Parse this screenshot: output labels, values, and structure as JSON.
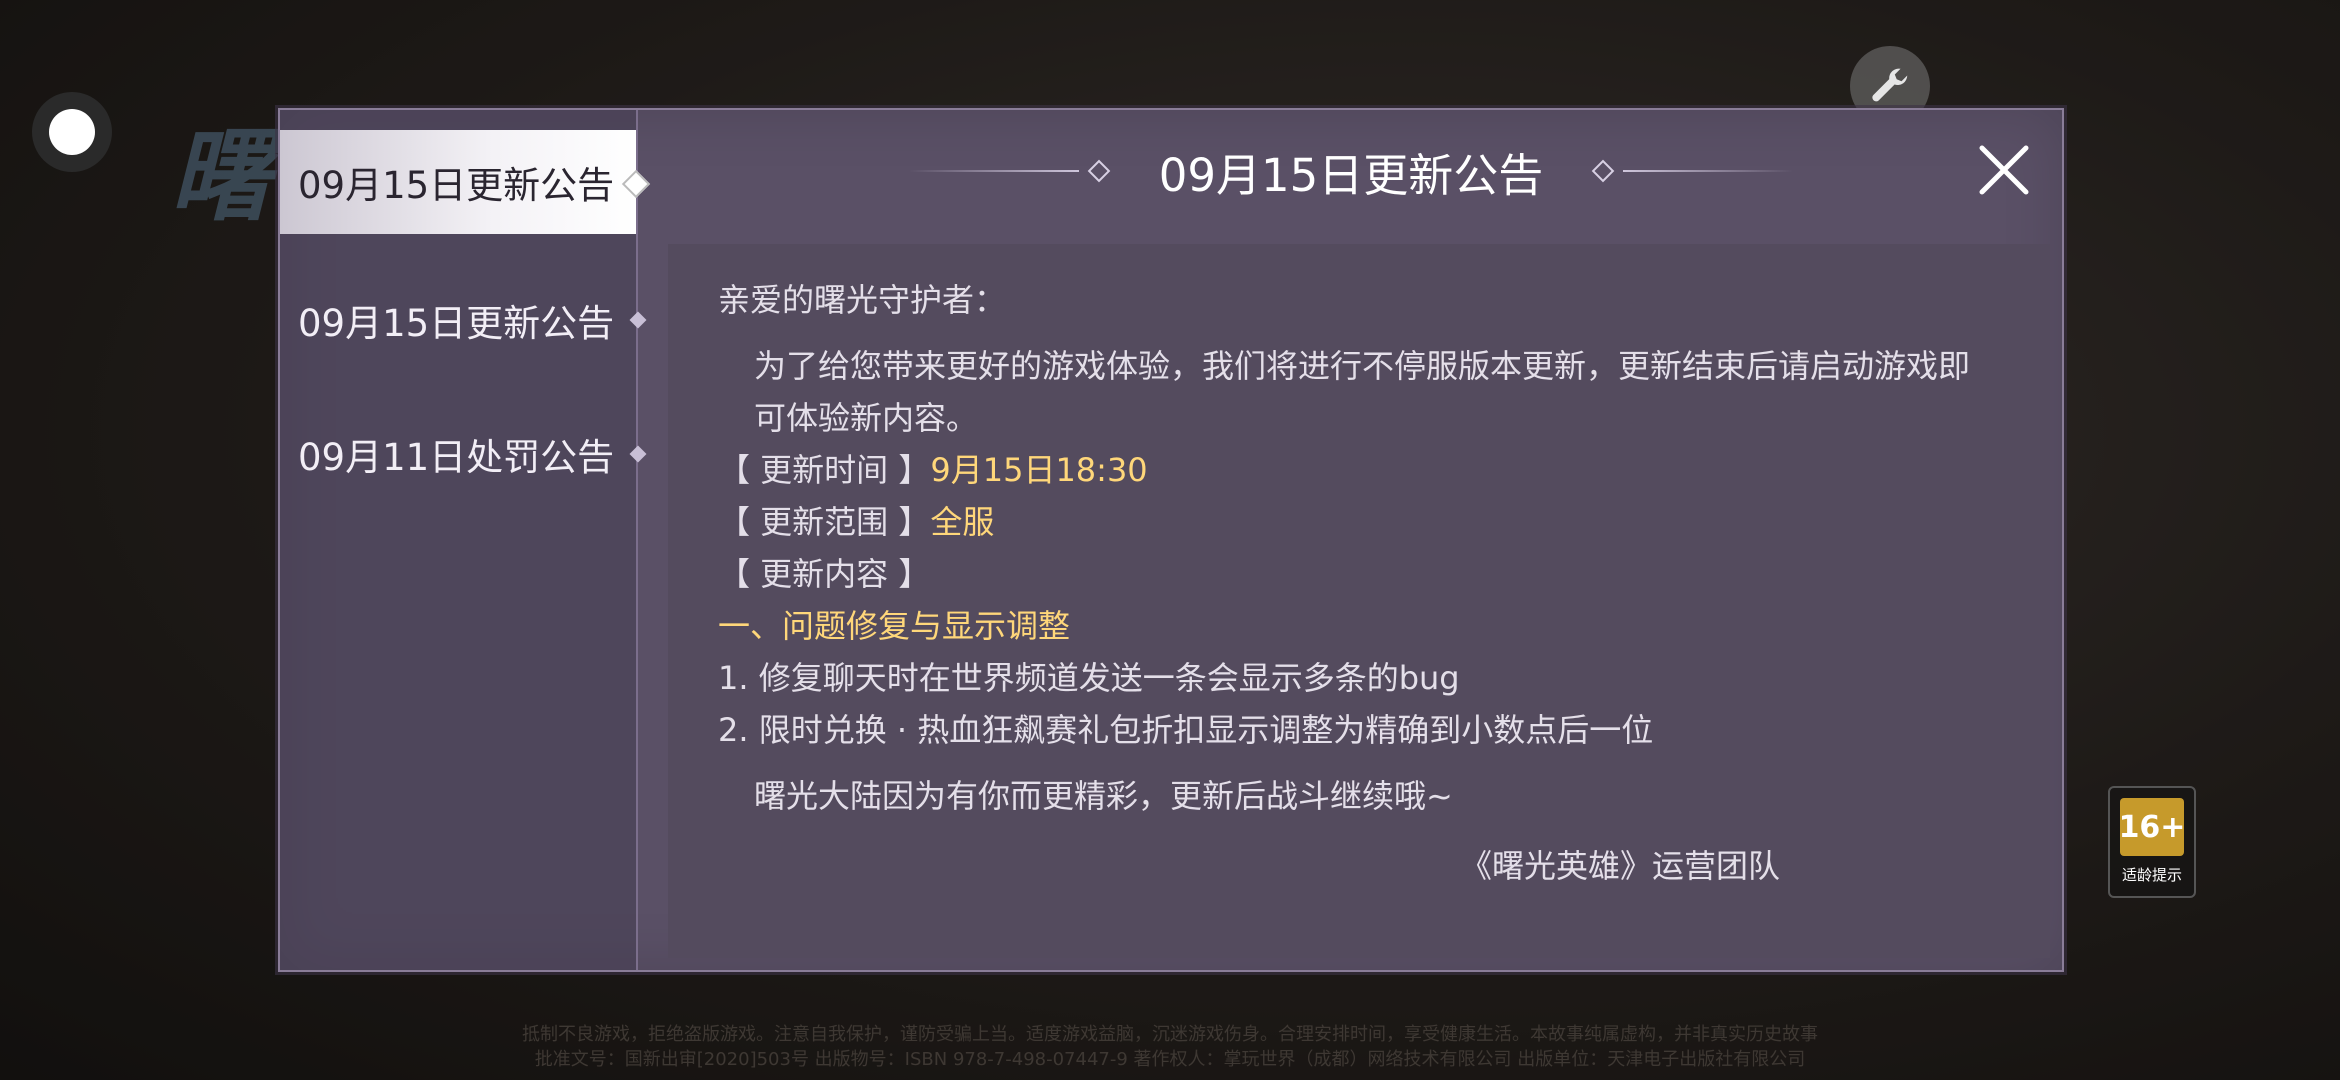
{
  "background": {
    "logo_text": "曙",
    "footer_line1": "抵制不良游戏，拒绝盗版游戏。注意自我保护，谨防受骗上当。适度游戏益脑，沉迷游戏伤身。合理安排时间，享受健康生活。本故事纯属虚构，并非真实历史故事",
    "footer_line2": "批准文号：国新出审[2020]503号 出版物号：ISBN 978-7-498-07447-9 著作权人：掌玩世界（成都）网络技术有限公司 出版单位：天津电子出版社有限公司"
  },
  "age_badge": {
    "rating": "16+",
    "label": "适龄提示"
  },
  "dialog": {
    "title": "09月15日更新公告",
    "tabs": [
      {
        "label": "09月15日更新公告",
        "active": true
      },
      {
        "label": "09月15日更新公告",
        "active": false
      },
      {
        "label": "09月11日处罚公告",
        "active": false
      }
    ],
    "content": {
      "greeting": "亲爱的曙光守护者：",
      "intro": "为了给您带来更好的游戏体验，我们将进行不停服版本更新，更新结束后请启动游戏即可体验新内容。",
      "time_label": "【 更新时间 】",
      "time_value": "9月15日18:30",
      "scope_label": "【 更新范围 】",
      "scope_value": "全服",
      "content_label": "【 更新内容 】",
      "section_title": "一、问题修复与显示调整",
      "items": [
        "1. 修复聊天时在世界频道发送一条会显示多条的bug",
        "2. 限时兑换 · 热血狂飙赛礼包折扣显示调整为精确到小数点后一位"
      ],
      "closing": "曙光大陆因为有你而更精彩，更新后战斗继续哦~",
      "signature": "《曙光英雄》运营团队"
    }
  },
  "colors": {
    "highlight": "#ffd77a",
    "panel": "#5a5066"
  }
}
